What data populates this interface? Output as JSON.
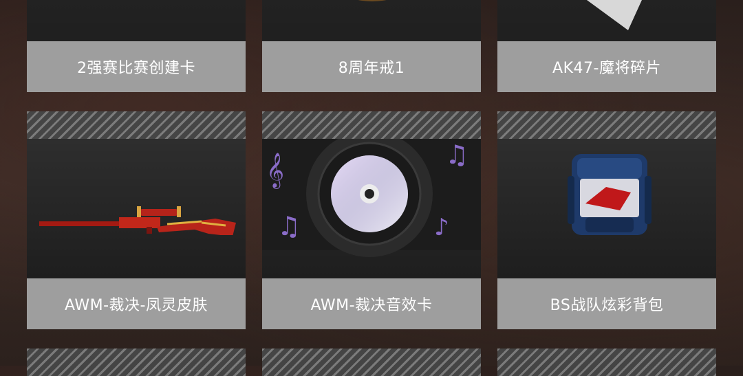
{
  "rows": [
    {
      "items": [
        {
          "label": "2强赛比赛创建卡",
          "icon": "match-card-icon"
        },
        {
          "label": "8周年戒1",
          "icon": "ring-icon"
        },
        {
          "label": "AK47-魔将碎片",
          "icon": "fragment-icon"
        }
      ]
    },
    {
      "items": [
        {
          "label": "AWM-裁决-凤灵皮肤",
          "icon": "sniper-rifle-icon"
        },
        {
          "label": "AWM-裁决音效卡",
          "icon": "music-disc-icon"
        },
        {
          "label": "BS战队炫彩背包",
          "icon": "backpack-icon"
        }
      ]
    }
  ],
  "colors": {
    "label_bg": "#9e9e9e",
    "thumb_bg": "#2a2a2a",
    "page_bg": "#2f2420"
  }
}
